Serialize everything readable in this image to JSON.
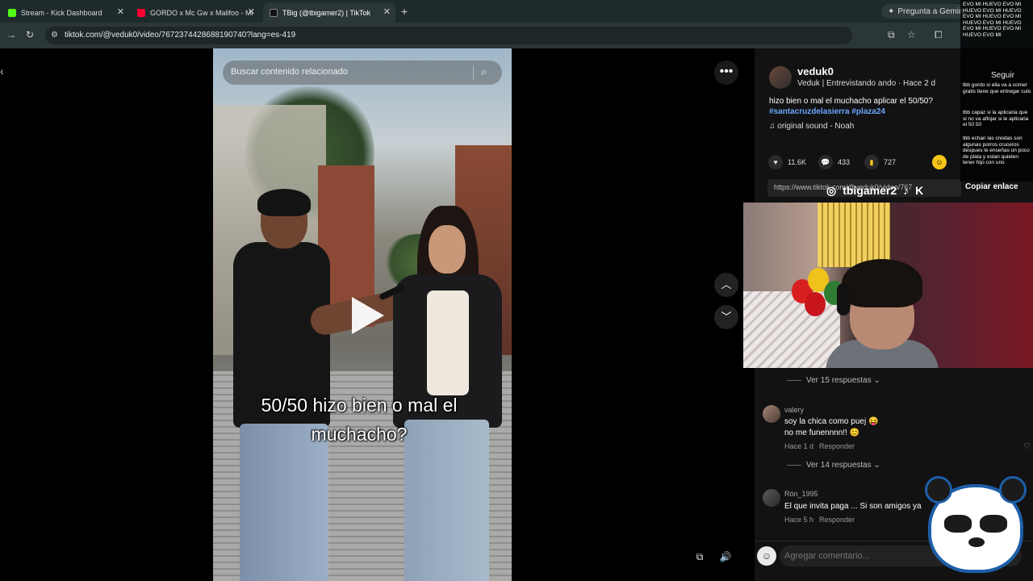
{
  "browser": {
    "tabs": [
      {
        "title": "Stream - Kick Dashboard",
        "color": "#53fc18"
      },
      {
        "title": "GORDO x Mc Gw x Malifoo - Mi",
        "color": "#ff0033"
      },
      {
        "title": "TBig (@tbigamer2) | TikTok",
        "color": "#111111"
      }
    ],
    "url": "tiktok.com/@veduk0/video/7672374428688190740?lang=es-419",
    "gemini_label": "Pregunta a Gemini"
  },
  "video": {
    "search_placeholder": "Buscar contenido relacionado",
    "caption_line1": "50/50 hizo bien o mal el",
    "caption_line2": "muchacho?"
  },
  "post": {
    "username": "veduk0",
    "subtitle": "Veduk | Entrevistando ando · Hace 2 d",
    "description": "hizo bien o mal el muchacho aplicar el 50/50?",
    "hashtags": "#santacruzdelasierra #plaza24",
    "sound": "original sound - Noah",
    "likes": "11.6K",
    "comments": "433",
    "saves": "727",
    "link": "https://www.tiktok.com/@veduk0/video/767",
    "copy_link": "Copiar enlace",
    "follow": "Seguir"
  },
  "overlay": {
    "handle": "tbigamer2"
  },
  "stream_chat": [
    "EVO MI HUEVO EVO MI HUEVO EVO MI HUEVO EVO MI HUEVO EVO MI HUEVO EVO MI HUEVO EVO MI HUEVO EVO MI HUEVO EVO MI",
    "tbb gordo si ella va a comer gratis tiene que entregar culo",
    "tbb capaz si la aplicaria que si no va aflojar si le aplicaria el 50 50",
    "tbb echan las creidas son algunas porros cruceros despues le enseñas un poco de plata y estan quieten tener hijo con uno"
  ],
  "comments": {
    "replies_1": "Ver 15 respuestas",
    "c1_name": "valery",
    "c1_text_1": "soy la chica como puej 😝",
    "c1_text_2": "no me funennnn!! 😊",
    "c1_time": "Hace 1 d",
    "c1_reply": "Responder",
    "replies_2": "Ver 14 respuestas",
    "c2_name": "Rón_1995",
    "c2_text": "El que invita paga ... Si son amigos ya",
    "c2_time": "Hace 5 h",
    "c2_reply": "Responder",
    "input_placeholder": "Agregar comentario..."
  }
}
